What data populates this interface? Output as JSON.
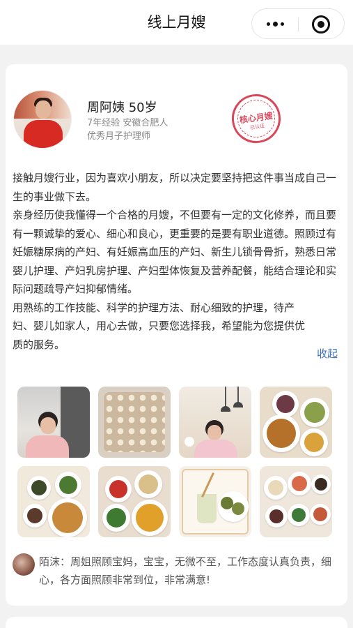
{
  "navbar": {
    "title": "线上月嫂",
    "menu_icon": "more-dots-icon",
    "close_icon": "target-circle-icon"
  },
  "profile": {
    "name_age": "周阿姨 50岁",
    "experience_location": "7年经验 安徽合肥人",
    "title": "优秀月子护理师",
    "stamp_main": "核心月嫂",
    "stamp_sub": "已认证",
    "stamp_color": "#d9485a"
  },
  "description": {
    "paragraphs": [
      "接触月嫂行业，因为喜欢小朋友，所以决定要坚持把这件事当成自己一生的事业做下去。",
      "亲身经历使我懂得一个合格的月嫂，不但要有一定的文化修养，而且要有一颗诚挚的爱心、细心和良心，更重要的是要有职业道德。照顾过有妊娠糖尿病的产妇、有妊娠高血压的产妇、新生儿锁骨骨折，熟悉日常婴儿护理、产妇乳房护理、产妇型体恢复及营养配餐，能结合理论和实际问题疏导产妇抑郁情绪。",
      "用熟练的工作技能、科学的护理方法、耐心细致的护理，待产妇、婴儿如家人，用心去做，只要您选择我，希望能为您提供优质的服务。"
    ],
    "collapse_label": "收起",
    "link_color": "#3b6fc4"
  },
  "photos": [
    "photo-caregiver-with-baby",
    "photo-tray-of-dumplings",
    "photo-caregiver-at-table",
    "photo-meal-plates",
    "photo-meal-noodles",
    "photo-meal-soup",
    "photo-drink-and-pancakes",
    "photo-meal-set"
  ],
  "review": {
    "text": "陌沫：周姐照顾宝妈，宝宝，无微不至，工作态度认真负责，细心，各方面照顾非常到位，非常满意!"
  }
}
